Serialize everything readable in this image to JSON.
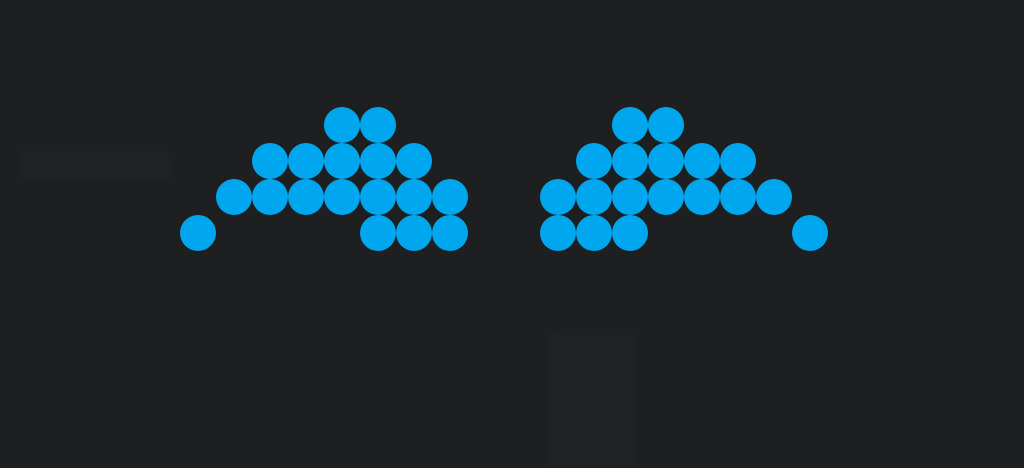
{
  "background_color": "#1e1f21",
  "dot_color": "#00a7ef",
  "left_eye": {
    "rows": [
      {
        "row": 0,
        "cols": [
          4,
          5
        ]
      },
      {
        "row": 1,
        "cols": [
          2,
          3,
          4,
          5,
          6
        ]
      },
      {
        "row": 2,
        "cols": [
          1,
          2,
          3,
          4,
          5,
          6,
          7
        ]
      },
      {
        "row": 3,
        "cols": [
          0,
          5,
          6,
          7
        ]
      }
    ]
  },
  "right_eye": {
    "rows": [
      {
        "row": 0,
        "cols": [
          2,
          3
        ]
      },
      {
        "row": 1,
        "cols": [
          1,
          2,
          3,
          4,
          5
        ]
      },
      {
        "row": 2,
        "cols": [
          0,
          1,
          2,
          3,
          4,
          5,
          6
        ]
      },
      {
        "row": 3,
        "cols": [
          0,
          1,
          2,
          7
        ]
      }
    ]
  }
}
